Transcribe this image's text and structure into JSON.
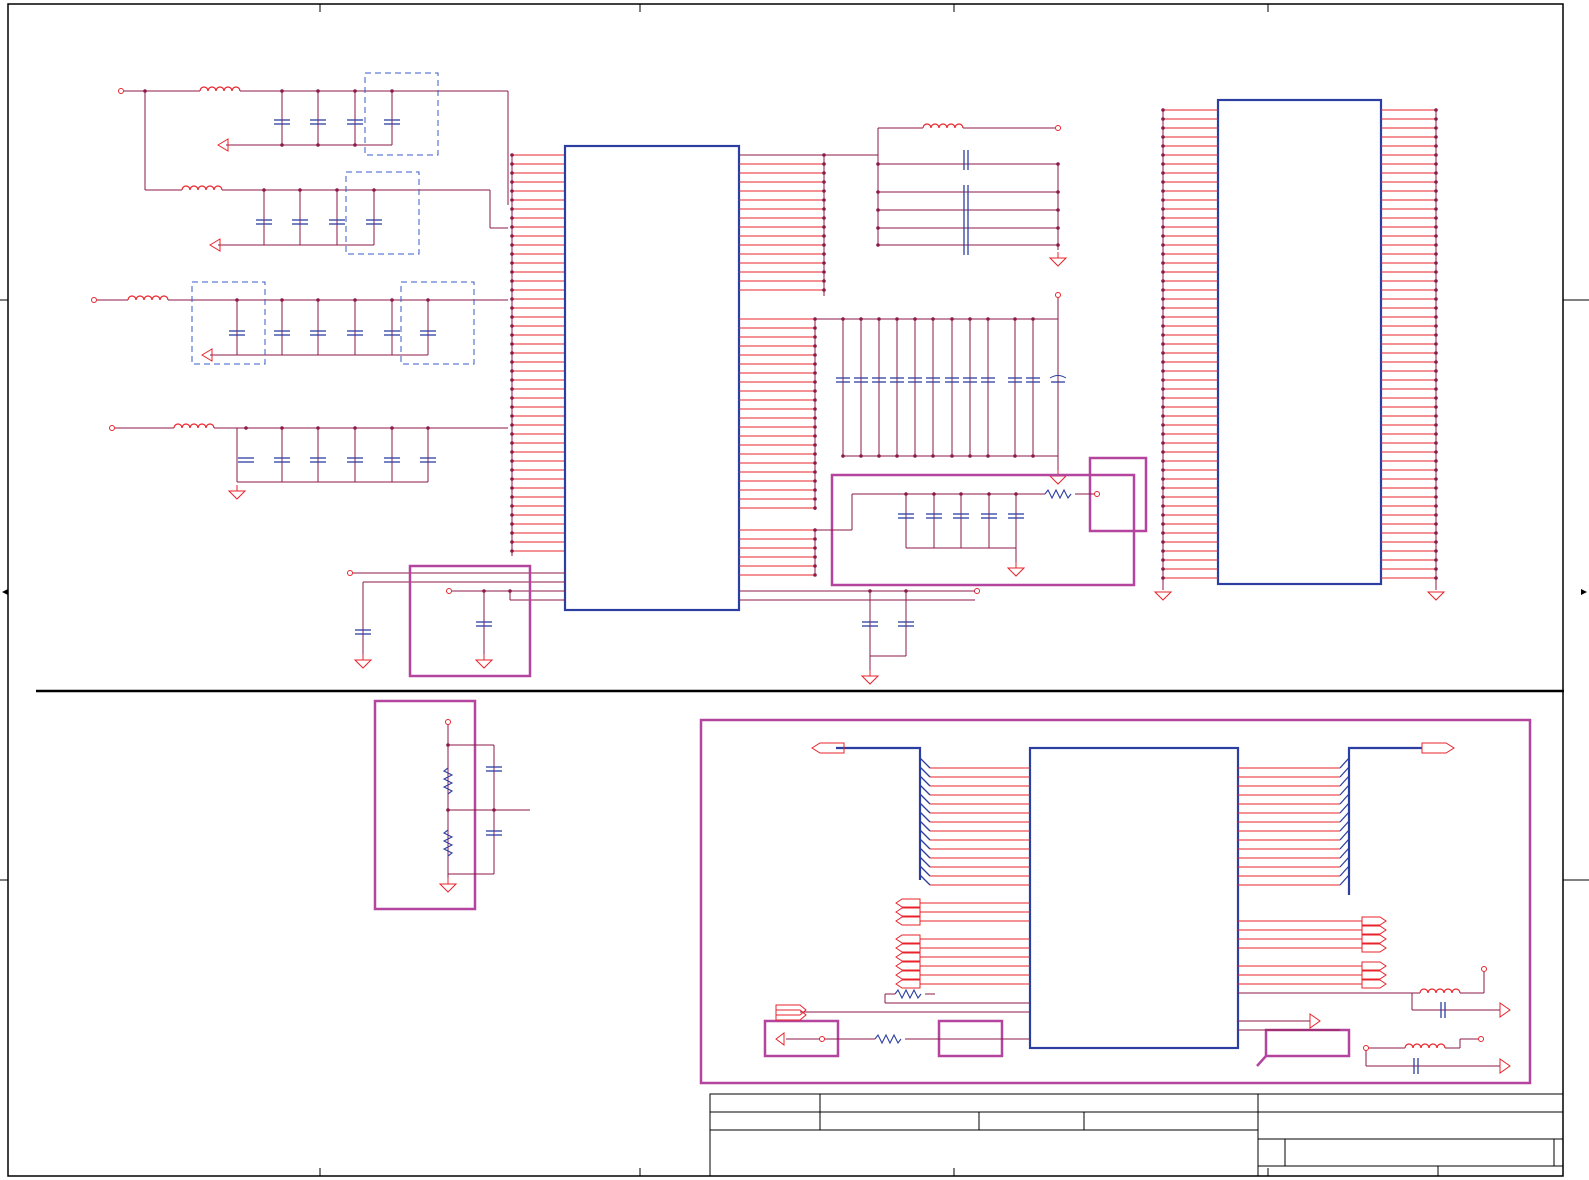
{
  "sheet": {
    "title": "",
    "size": "",
    "document_number": "",
    "revision": "",
    "date": "",
    "sheet_of": ""
  },
  "colors": {
    "wire": "#8b1a4a",
    "pin": "#e8232b",
    "component": "#2c3fa0",
    "group_box": "#b5449e",
    "dashed_box": "#3a5bc7",
    "border": "#000000",
    "background": "#ffffff"
  },
  "icons": [
    "ground-symbol-icon",
    "inductor-icon",
    "capacitor-icon",
    "resistor-icon",
    "power-port-icon",
    "off-page-connector-icon"
  ]
}
